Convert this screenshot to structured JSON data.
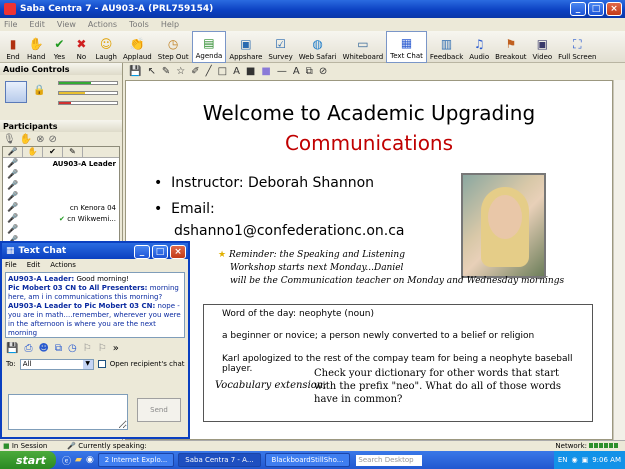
{
  "window": {
    "title": "Saba Centra 7 - AU903-A (PRL759154)"
  },
  "menubar": [
    "File",
    "Edit",
    "View",
    "Actions",
    "Tools",
    "Help"
  ],
  "toolbar": [
    {
      "label": "End",
      "icon": "door-icon"
    },
    {
      "label": "Hand",
      "icon": "hand-icon"
    },
    {
      "label": "Yes",
      "icon": "check-icon"
    },
    {
      "label": "No",
      "icon": "x-icon"
    },
    {
      "label": "Laugh",
      "icon": "smiley-icon"
    },
    {
      "label": "Applaud",
      "icon": "applaud-icon"
    },
    {
      "label": "Step Out",
      "icon": "clock-icon"
    },
    {
      "label": "Agenda",
      "icon": "agenda-icon"
    },
    {
      "label": "Appshare",
      "icon": "appshare-icon"
    },
    {
      "label": "Survey",
      "icon": "survey-icon"
    },
    {
      "label": "Web Safari",
      "icon": "globe-icon"
    },
    {
      "label": "Whiteboard",
      "icon": "whiteboard-icon"
    },
    {
      "label": "Text Chat",
      "icon": "chat-icon"
    },
    {
      "label": "Feedback",
      "icon": "feedback-icon"
    },
    {
      "label": "Audio",
      "icon": "audio-icon"
    },
    {
      "label": "Breakout",
      "icon": "breakout-icon"
    },
    {
      "label": "Video",
      "icon": "video-icon"
    },
    {
      "label": "Full Screen",
      "icon": "fullscreen-icon"
    }
  ],
  "left": {
    "audio_title": "Audio Controls",
    "participants_title": "Participants",
    "participants": [
      {
        "name": "AU903-A Leader"
      },
      {
        "name": "cn Kenora 04"
      },
      {
        "name": "cn Wikwemi..."
      }
    ]
  },
  "slide": {
    "title": "Welcome to Academic Upgrading",
    "subtitle": "Communications",
    "bullet1": "Instructor: Deborah Shannon",
    "bullet2_label": "Email:",
    "bullet2_value": "dshanno1@confederationc.on.ca",
    "reminder_line1": "Reminder: the Speaking and Listening",
    "reminder_line2": "Workshop starts next Monday...Daniel",
    "reminder_line3": "will be the Communication teacher on Monday and Wednesday mornings",
    "wod_title": "Word of the day: neophyte (noun)",
    "wod_def": "a beginner or novice; a person newly converted to a belief or religion",
    "wod_example": "Karl apologized to the rest of the compay team for being a neophyte baseball player.",
    "vocab_label": "Vocabulary extension:",
    "vocab_text": "Check your dictionary for other words that start with the prefix \"neo\". What do all of those words have in common?"
  },
  "chat": {
    "title": "Text Chat",
    "menu": [
      "File",
      "Edit",
      "Actions"
    ],
    "messages": [
      {
        "sender": "AU903-A Leader:",
        "text": "Good morning!"
      },
      {
        "sender": "Pic Mobert 03 CN to All Presenters:",
        "text": "morning here, am i in communications this morning?"
      },
      {
        "sender": "AU903-A Leader to Pic Mobert 03 CN:",
        "text": "nope - you are in math....remember, wherever you were in the afternoon is where you are the next morning"
      }
    ],
    "to_label": "To:",
    "to_value": "All",
    "open_chat_label": "Open recipient's chat",
    "send_label": "Send"
  },
  "status": {
    "session": "In Session",
    "speaking": "Currently speaking:",
    "network": "Network:"
  },
  "taskbar": {
    "start": "start",
    "tasks": [
      "2 Internet Explo...",
      "Saba Centra 7 - A...",
      "BlackboardStillSho..."
    ],
    "search_placeholder": "Search Desktop",
    "lang": "EN",
    "time": "9:06 AM"
  }
}
